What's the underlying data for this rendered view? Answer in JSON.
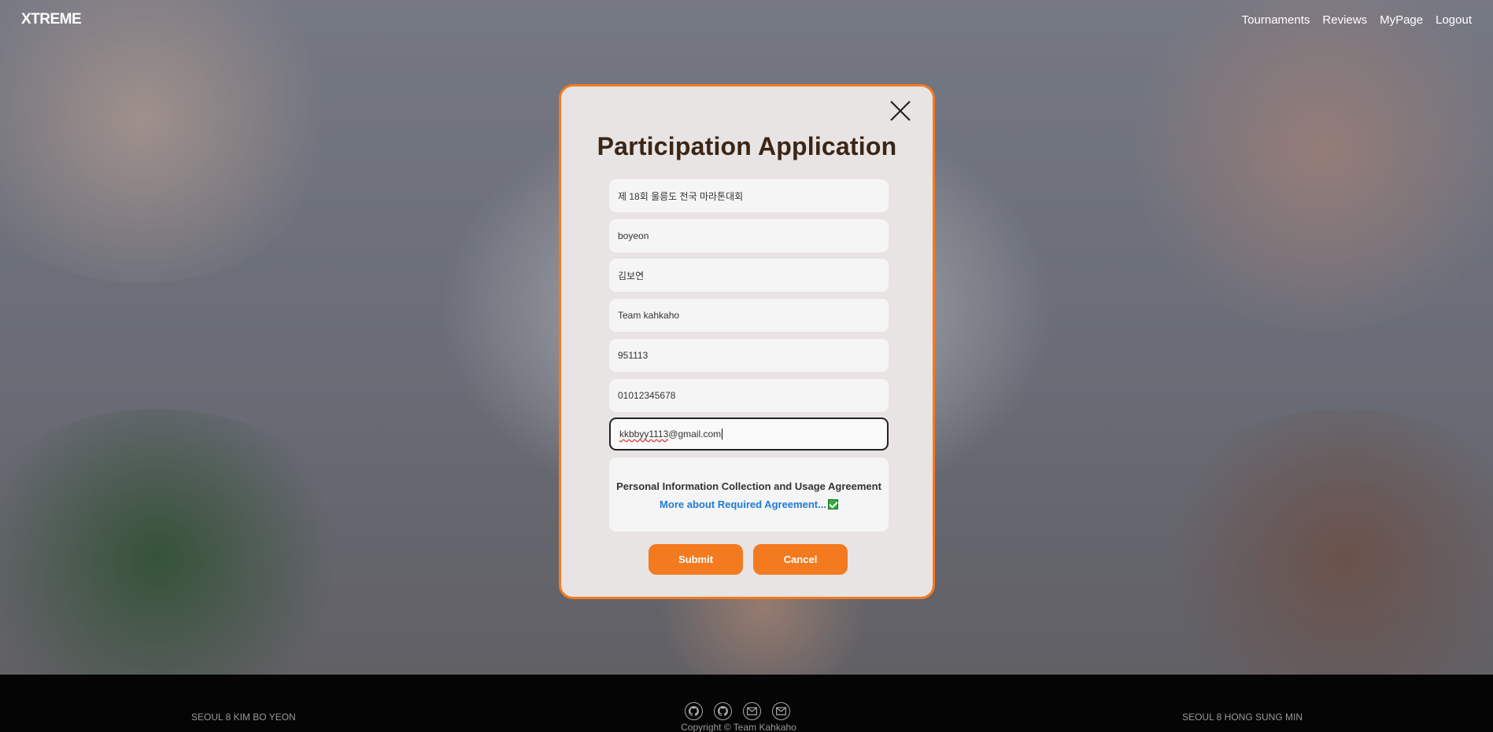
{
  "nav": {
    "logo": "XTREME",
    "links": [
      "Tournaments",
      "Reviews",
      "MyPage",
      "Logout"
    ]
  },
  "modal": {
    "title": "Participation Application",
    "fields": [
      "제 18회 울릉도 전국 마라톤대회",
      "boyeon",
      "김보연",
      "Team kahkaho",
      "951113",
      "01012345678"
    ],
    "email": {
      "underlined_part": "kkbbyy1113",
      "rest": "@gmail.com"
    },
    "agreement_title": "Personal Information Collection and Usage Agreement",
    "agreement_link": "More about Required Agreement...",
    "submit": "Submit",
    "cancel": "Cancel"
  },
  "footer": {
    "left": "SEOUL 8 KIM BO YEON",
    "right": "SEOUL 8 HONG SUNG MIN",
    "copyright": "Copyright © Team Kahkaho",
    "icons": [
      "github-icon",
      "github-icon",
      "mail-icon",
      "mail-icon"
    ]
  },
  "colors": {
    "accent": "#f47a1f",
    "modal_bg": "#e7e4e3",
    "title": "#3b2516",
    "link": "#1e7bd8"
  }
}
